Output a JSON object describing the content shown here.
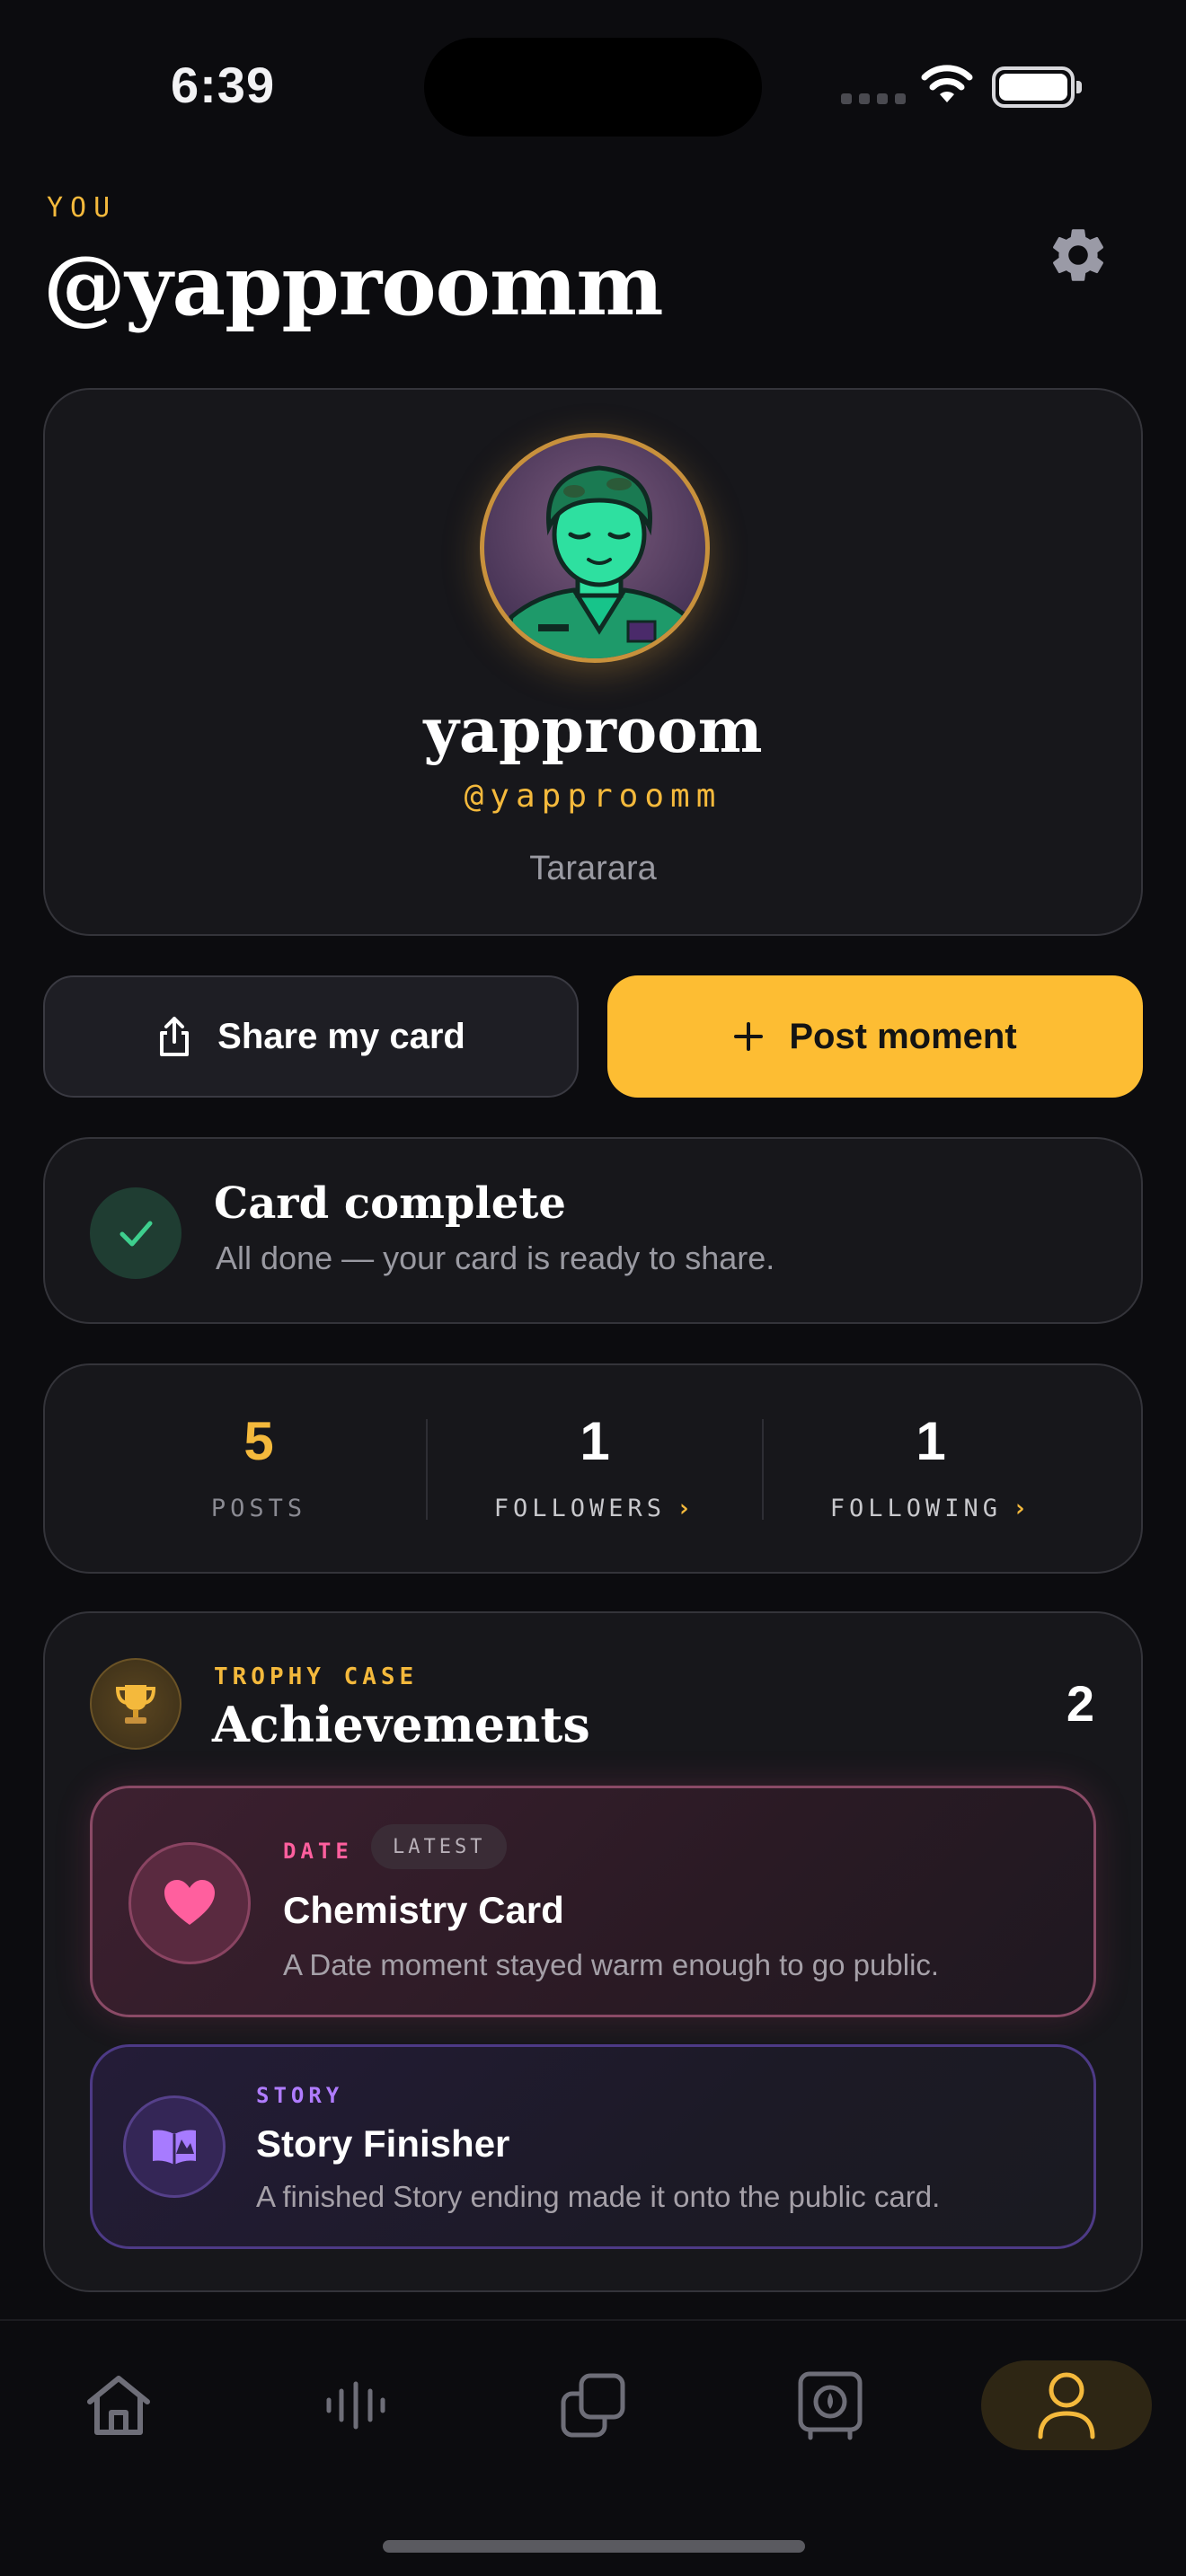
{
  "status_bar": {
    "time": "6:39"
  },
  "header": {
    "eyebrow": "YOU",
    "title": "@yapproomm"
  },
  "profile": {
    "name": "yapproom",
    "handle": "@yapproomm",
    "bio": "Tararara"
  },
  "actions": {
    "share_label": "Share my card",
    "post_label": "Post moment"
  },
  "completion": {
    "title": "Card complete",
    "subtitle": "All done — your card is ready to share."
  },
  "stats": [
    {
      "value": "5",
      "label": "POSTS"
    },
    {
      "value": "1",
      "label": "FOLLOWERS"
    },
    {
      "value": "1",
      "label": "FOLLOWING"
    }
  ],
  "trophy": {
    "eyebrow": "TROPHY CASE",
    "title": "Achievements",
    "count": "2",
    "items": [
      {
        "tag": "DATE",
        "badge": "LATEST",
        "title": "Chemistry Card",
        "description": "A Date moment stayed warm enough to go public.",
        "icon": "heart-icon"
      },
      {
        "tag": "STORY",
        "title": "Story Finisher",
        "description": "A finished Story ending made it onto the public card.",
        "icon": "book-icon"
      }
    ]
  },
  "tabs": [
    {
      "icon": "home-icon"
    },
    {
      "icon": "audio-wave-icon"
    },
    {
      "icon": "cards-icon"
    },
    {
      "icon": "vault-icon"
    },
    {
      "icon": "profile-icon",
      "active": true
    }
  ],
  "colors": {
    "accent": "#fdbd33",
    "background": "#0c0c0f",
    "date_pink": "#ff5f9e",
    "story_purple": "#b07cff",
    "success_green": "#3ecf8e"
  }
}
